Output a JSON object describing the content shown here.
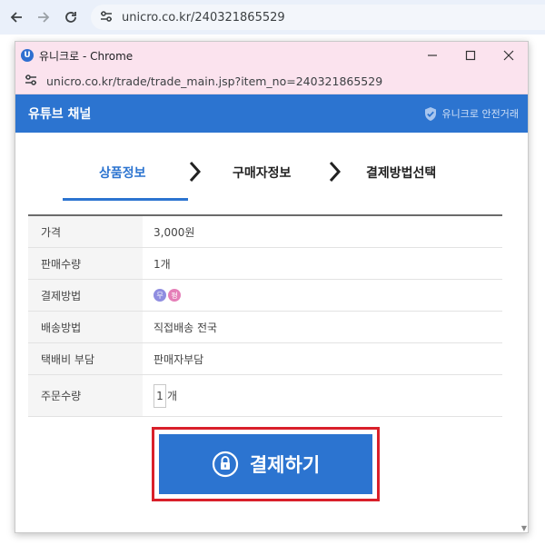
{
  "browser": {
    "url": "unicro.co.kr/240321865529"
  },
  "popup": {
    "title": "유니크로 - Chrome",
    "logo_letter": "U",
    "address": "unicro.co.kr/trade/trade_main.jsp?item_no=240321865529"
  },
  "header": {
    "title": "유튜브 채널",
    "safe_label": "유니크로 안전거래"
  },
  "steps": [
    {
      "label": "상품정보",
      "active": true
    },
    {
      "label": "구매자정보",
      "active": false
    },
    {
      "label": "결제방법선택",
      "active": false
    }
  ],
  "table": {
    "price_label": "가격",
    "price_value": "3,000원",
    "quantity_label": "판매수량",
    "quantity_value": "1개",
    "payment_label": "결제방법",
    "payment_icons": [
      "무",
      "평"
    ],
    "shipping_label": "배송방법",
    "shipping_value": "직접배송 전국",
    "fee_label": "택배비 부담",
    "fee_value": "판매자부담",
    "order_label": "주문수량",
    "order_qty": "1",
    "order_unit": "개"
  },
  "pay_button": {
    "label": "결제하기"
  },
  "colors": {
    "accent": "#2c74d0",
    "highlight": "#d9202a",
    "titlebar": "#fbe3ee",
    "pay_icon_1": "#8f8de0",
    "pay_icon_2": "#e57fb8"
  }
}
